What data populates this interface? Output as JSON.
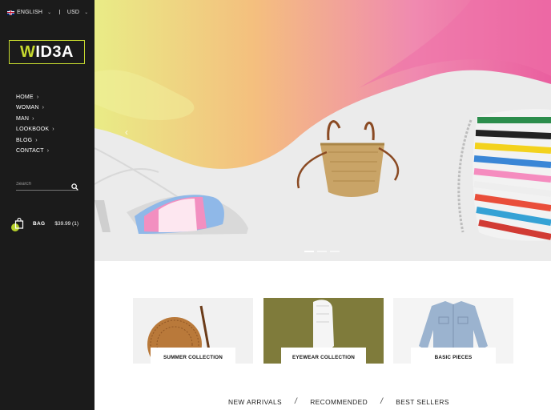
{
  "topbar": {
    "language": "ENGLISH",
    "separator": "I",
    "currency": "USD",
    "caret": "⌄"
  },
  "brand": {
    "logo_first": "W",
    "logo_rest": "ID3A",
    "accent_color": "#c6d92f"
  },
  "nav": {
    "items": [
      {
        "label": "HOME"
      },
      {
        "label": "WOMAN"
      },
      {
        "label": "MAN"
      },
      {
        "label": "LOOKBOOK"
      },
      {
        "label": "BLOG"
      },
      {
        "label": "CONTACT"
      }
    ],
    "chevron": "›"
  },
  "search": {
    "placeholder": "Search"
  },
  "bag": {
    "label": "BAG",
    "summary": "$39.99 (1)"
  },
  "hero": {
    "prev_arrow": "‹",
    "slide_count": 3,
    "active_slide": 1
  },
  "collections": [
    {
      "label": "SUMMER COLLECTION"
    },
    {
      "label": "EYEWEAR COLLECTION"
    },
    {
      "label": "BASIC PIECES"
    }
  ],
  "tabs": {
    "items": [
      "NEW ARRIVALS",
      "RECOMMENDED",
      "BEST SELLERS"
    ],
    "separator": "/"
  }
}
